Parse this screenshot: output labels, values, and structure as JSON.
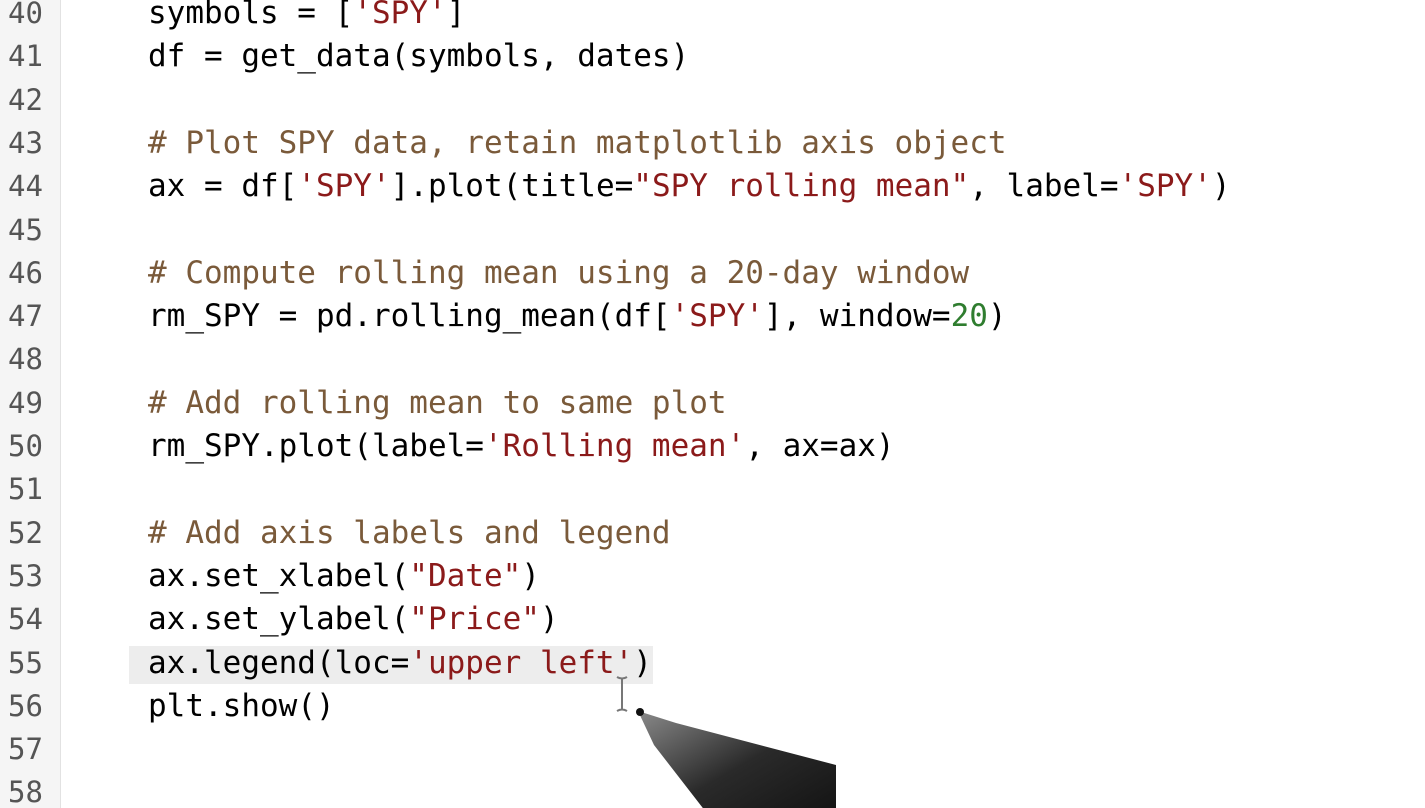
{
  "editor": {
    "lines": [
      {
        "number": "40",
        "tokens": [
          {
            "t": "symbols = [",
            "c": "plain"
          },
          {
            "t": "'SPY'",
            "c": "string"
          },
          {
            "t": "]",
            "c": "plain"
          }
        ]
      },
      {
        "number": "41",
        "tokens": [
          {
            "t": "df = get_data(symbols, dates)",
            "c": "plain"
          }
        ]
      },
      {
        "number": "42",
        "tokens": []
      },
      {
        "number": "43",
        "tokens": [
          {
            "t": "# Plot SPY data, retain matplotlib axis object",
            "c": "comment"
          }
        ]
      },
      {
        "number": "44",
        "tokens": [
          {
            "t": "ax = df[",
            "c": "plain"
          },
          {
            "t": "'SPY'",
            "c": "string"
          },
          {
            "t": "].plot(title=",
            "c": "plain"
          },
          {
            "t": "\"SPY rolling mean\"",
            "c": "string"
          },
          {
            "t": ", label=",
            "c": "plain"
          },
          {
            "t": "'SPY'",
            "c": "string"
          },
          {
            "t": ")",
            "c": "plain"
          }
        ]
      },
      {
        "number": "45",
        "tokens": []
      },
      {
        "number": "46",
        "tokens": [
          {
            "t": "# Compute rolling mean using a 20-day window",
            "c": "comment"
          }
        ]
      },
      {
        "number": "47",
        "tokens": [
          {
            "t": "rm_SPY = pd.rolling_mean(df[",
            "c": "plain"
          },
          {
            "t": "'SPY'",
            "c": "string"
          },
          {
            "t": "], window=",
            "c": "plain"
          },
          {
            "t": "20",
            "c": "number"
          },
          {
            "t": ")",
            "c": "plain"
          }
        ]
      },
      {
        "number": "48",
        "tokens": []
      },
      {
        "number": "49",
        "tokens": [
          {
            "t": "# Add rolling mean to same plot",
            "c": "comment"
          }
        ]
      },
      {
        "number": "50",
        "tokens": [
          {
            "t": "rm_SPY.plot(label=",
            "c": "plain"
          },
          {
            "t": "'Rolling mean'",
            "c": "string"
          },
          {
            "t": ", ax=ax)",
            "c": "plain"
          }
        ]
      },
      {
        "number": "51",
        "tokens": []
      },
      {
        "number": "52",
        "tokens": [
          {
            "t": "# Add axis labels and legend",
            "c": "comment"
          }
        ]
      },
      {
        "number": "53",
        "tokens": [
          {
            "t": "ax.set_xlabel(",
            "c": "plain"
          },
          {
            "t": "\"Date\"",
            "c": "string"
          },
          {
            "t": ")",
            "c": "plain"
          }
        ]
      },
      {
        "number": "54",
        "tokens": [
          {
            "t": "ax.set_ylabel(",
            "c": "plain"
          },
          {
            "t": "\"Price\"",
            "c": "string"
          },
          {
            "t": ")",
            "c": "plain"
          }
        ]
      },
      {
        "number": "55",
        "selected": true,
        "tokens": [
          {
            "t": "ax.legend(loc=",
            "c": "plain"
          },
          {
            "t": "'upper left'",
            "c": "string"
          },
          {
            "t": ")",
            "c": "plain"
          }
        ]
      },
      {
        "number": "56",
        "tokens": [
          {
            "t": "plt.show()",
            "c": "plain"
          }
        ]
      },
      {
        "number": "57",
        "tokens": []
      },
      {
        "number": "58",
        "tokens": []
      }
    ]
  },
  "colors": {
    "comment": "#7a5a3a",
    "string": "#8b1a1a",
    "number": "#2f7d2f",
    "plain": "#000000",
    "selection": "#ededed"
  },
  "icons": {
    "cursor": "i-beam-cursor-icon",
    "pointer": "stylus-pencil-icon"
  }
}
